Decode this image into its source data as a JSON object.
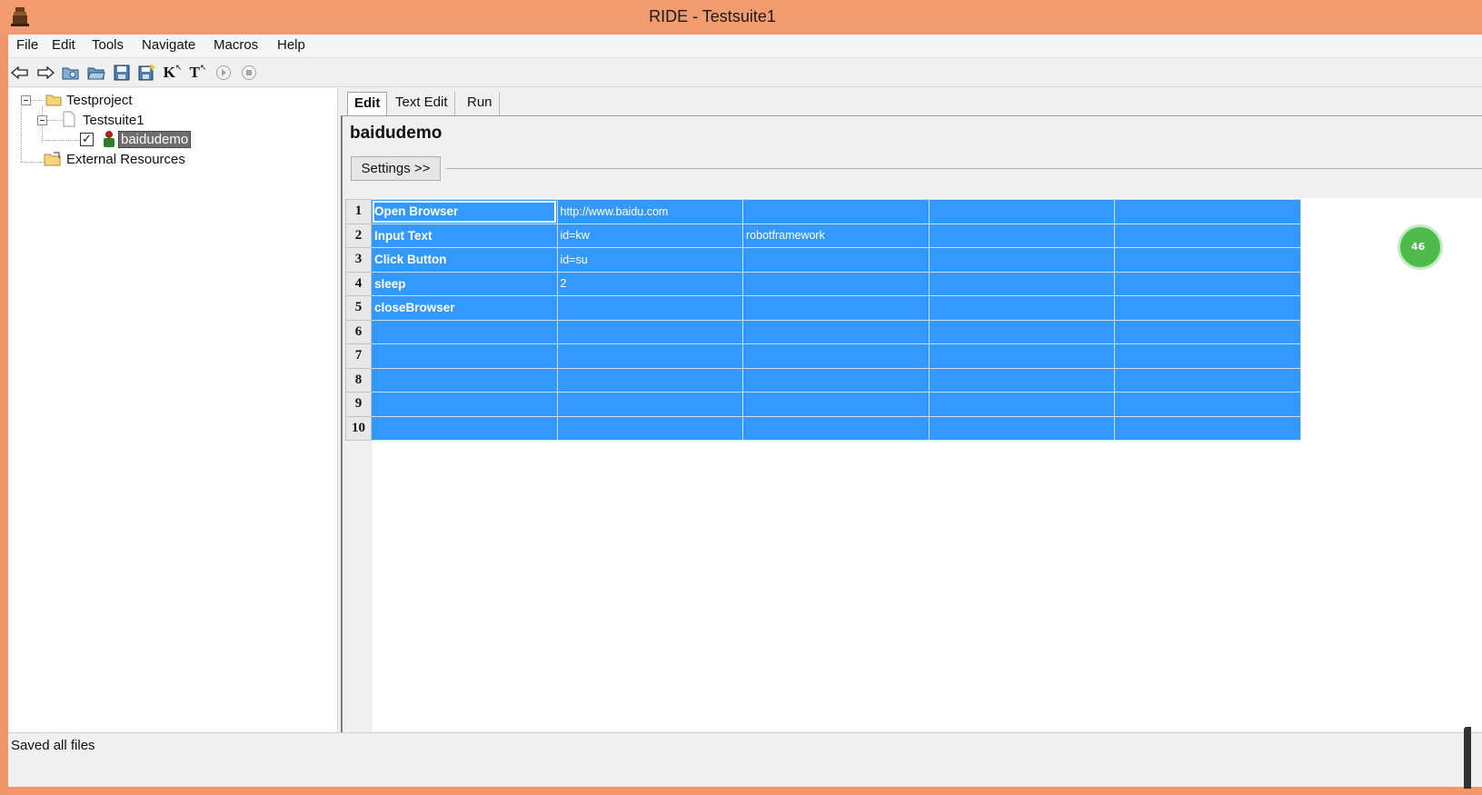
{
  "window": {
    "title": "RIDE - Testsuite1"
  },
  "menu": [
    "File",
    "Edit",
    "Tools",
    "Navigate",
    "Macros",
    "Help"
  ],
  "toolbar": {
    "keyword_label": "K",
    "testcase_label": "T"
  },
  "tree": {
    "project": "Testproject",
    "suite": "Testsuite1",
    "testcase": "baidudemo",
    "testcase_checked": "✓",
    "resources": "External Resources"
  },
  "tabs": [
    "Edit",
    "Text Edit",
    "Run"
  ],
  "editor": {
    "test_name": "baidudemo",
    "settings_button": "Settings >>"
  },
  "grid": {
    "rows": [
      {
        "num": "1",
        "cells": [
          "Open Browser",
          "http://www.baidu.com",
          "",
          "",
          ""
        ]
      },
      {
        "num": "2",
        "cells": [
          "Input Text",
          "id=kw",
          "robotframework",
          "",
          ""
        ]
      },
      {
        "num": "3",
        "cells": [
          "Click Button",
          "id=su",
          "",
          "",
          ""
        ]
      },
      {
        "num": "4",
        "cells": [
          "sleep",
          "2",
          "",
          "",
          ""
        ]
      },
      {
        "num": "5",
        "cells": [
          "closeBrowser",
          "",
          "",
          "",
          ""
        ]
      },
      {
        "num": "6",
        "cells": [
          "",
          "",
          "",
          "",
          ""
        ]
      },
      {
        "num": "7",
        "cells": [
          "",
          "",
          "",
          "",
          ""
        ]
      },
      {
        "num": "8",
        "cells": [
          "",
          "",
          "",
          "",
          ""
        ]
      },
      {
        "num": "9",
        "cells": [
          "",
          "",
          "",
          "",
          ""
        ]
      },
      {
        "num": "10",
        "cells": [
          "",
          "",
          "",
          "",
          ""
        ]
      }
    ]
  },
  "status": {
    "text": "Saved all files"
  },
  "badge": {
    "text": "46"
  },
  "colors": {
    "titlebar": "#f29b70",
    "selection": "#3399ff"
  }
}
